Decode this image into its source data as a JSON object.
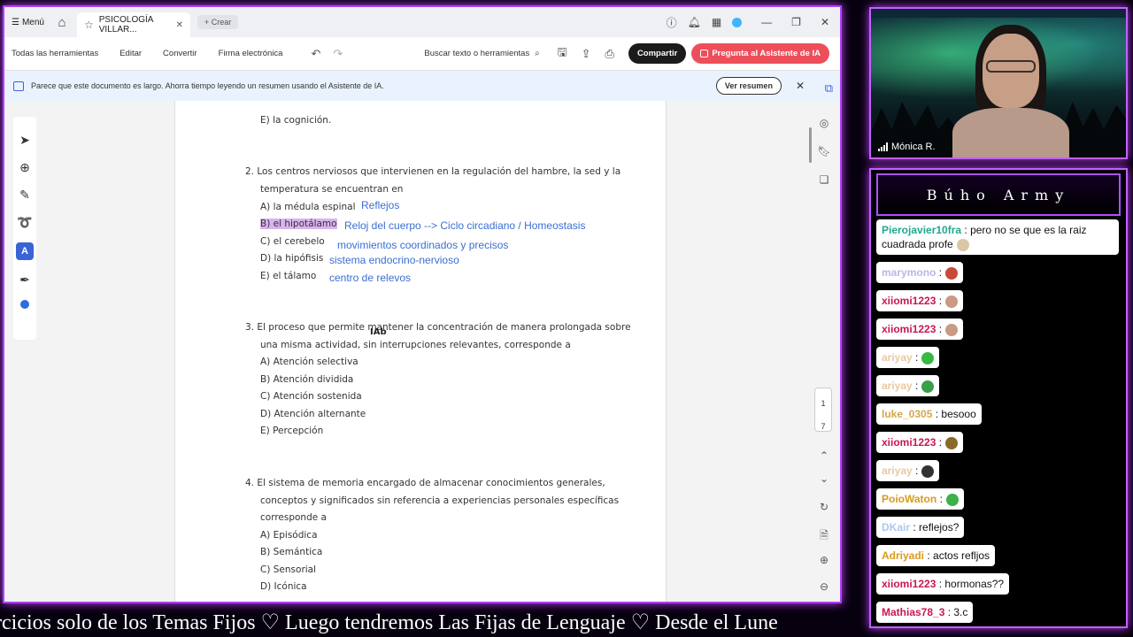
{
  "window": {
    "menu_label": "Menú",
    "tab_title": "PSICOLOGÍA VILLAR...",
    "create_label": "Crear"
  },
  "toolbar": {
    "all_tools": "Todas las herramientas",
    "edit": "Editar",
    "convert": "Convertir",
    "esign": "Firma electrónica",
    "search_label": "Buscar texto o herramientas",
    "share": "Compartir",
    "ai_assistant": "Pregunta al Asistente de IA"
  },
  "banner": {
    "text": "Parece que este documento es largo. Ahorra tiempo leyendo un resumen usando el Asistente de IA.",
    "button": "Ver resumen"
  },
  "document": {
    "prev_option": "E)  la cognición.",
    "q2": {
      "line1": "2.   Los centros nerviosos que intervienen en la regulación del hambre, la sed y la",
      "line2": "temperatura se encuentran en",
      "options": [
        "A)  la médula espinal",
        "B)  el hipotálamo",
        "C)  el cerebelo",
        "D)  la hipófisis",
        "E)  el tálamo"
      ],
      "annotations": [
        "Reflejos",
        "Reloj del cuerpo --> Ciclo circadiano / Homeostasis",
        "movimientos coordinados y precisos",
        "sistema endocrino-nervioso",
        "centro de relevos"
      ]
    },
    "q3": {
      "line1": "3.   El proceso que permite mantener la concentración de manera prolongada sobre",
      "line2": "una misma actividad, sin interrupciones relevantes, corresponde a",
      "options": [
        "A)  Atención selectiva",
        "B)  Atención dividida",
        "C)  Atención sostenida",
        "D)  Atención alternante",
        "E)  Percepción"
      ]
    },
    "q4": {
      "line1": "4.   El sistema de memoria encargado de almacenar conocimientos generales,",
      "line2": "conceptos y significados sin referencia a experiencias personales específicas",
      "line3": "corresponde a",
      "options": [
        "A)  Episódica",
        "B)  Semántica",
        "C)  Sensorial",
        "D)  Icónica"
      ]
    },
    "cursor_text": "IAb",
    "page_current": "1",
    "page_total": "7"
  },
  "webcam": {
    "name": "Mónica R."
  },
  "chat": {
    "title": "Búho Army",
    "messages": [
      {
        "user": "Pierojavier10fra",
        "text": ": pero no se que es la raiz cuadrada profe",
        "color": "#1fa88f"
      },
      {
        "user": "marymono",
        "text": ":",
        "color": "#b7b7e8"
      },
      {
        "user": "xiiomi1223",
        "text": ":",
        "color": "#c8174f"
      },
      {
        "user": "xiiomi1223",
        "text": ":",
        "color": "#c8174f"
      },
      {
        "user": "ariyay",
        "text": ":",
        "color": "#e8c9a0"
      },
      {
        "user": "ariyay",
        "text": ":",
        "color": "#e8c9a0"
      },
      {
        "user": "luke_0305",
        "text": ": besooo",
        "color": "#d4a84b"
      },
      {
        "user": "xiiomi1223",
        "text": ":",
        "color": "#c8174f"
      },
      {
        "user": "ariyay",
        "text": ":",
        "color": "#e8c9a0"
      },
      {
        "user": "PoioWaton",
        "text": ":",
        "color": "#d89a1c"
      },
      {
        "user": "DKair",
        "text": ": reflejos?",
        "color": "#a9c8ef"
      },
      {
        "user": "Adriyadi",
        "text": ": actos refljos",
        "color": "#d89a1c"
      },
      {
        "user": "xiiomi1223",
        "text": ": hormonas??",
        "color": "#c8174f"
      },
      {
        "user": "Mathias78_3",
        "text": ": 3.c",
        "color": "#c8174f"
      }
    ],
    "emote_colors": [
      "#d9c7a5",
      "#c74a3a",
      "#c99a86",
      "#c99a86",
      "#38b845",
      "#38a048",
      null,
      "#8a6a2a",
      "#333",
      "#3cb04a",
      null,
      null,
      null,
      null
    ]
  },
  "ticker": {
    "text": "rcicios solo de los Temas Fijos   ♡   Luego tendremos Las Fijas de Lenguaje   ♡   Desde el Lune"
  },
  "colors": {
    "neon": "#c040ff",
    "share_bg": "#1b1b1b",
    "ai_bg": "#ed4f5a",
    "annotation": "#3a6fd1",
    "highlight": "#d8b3ef"
  }
}
